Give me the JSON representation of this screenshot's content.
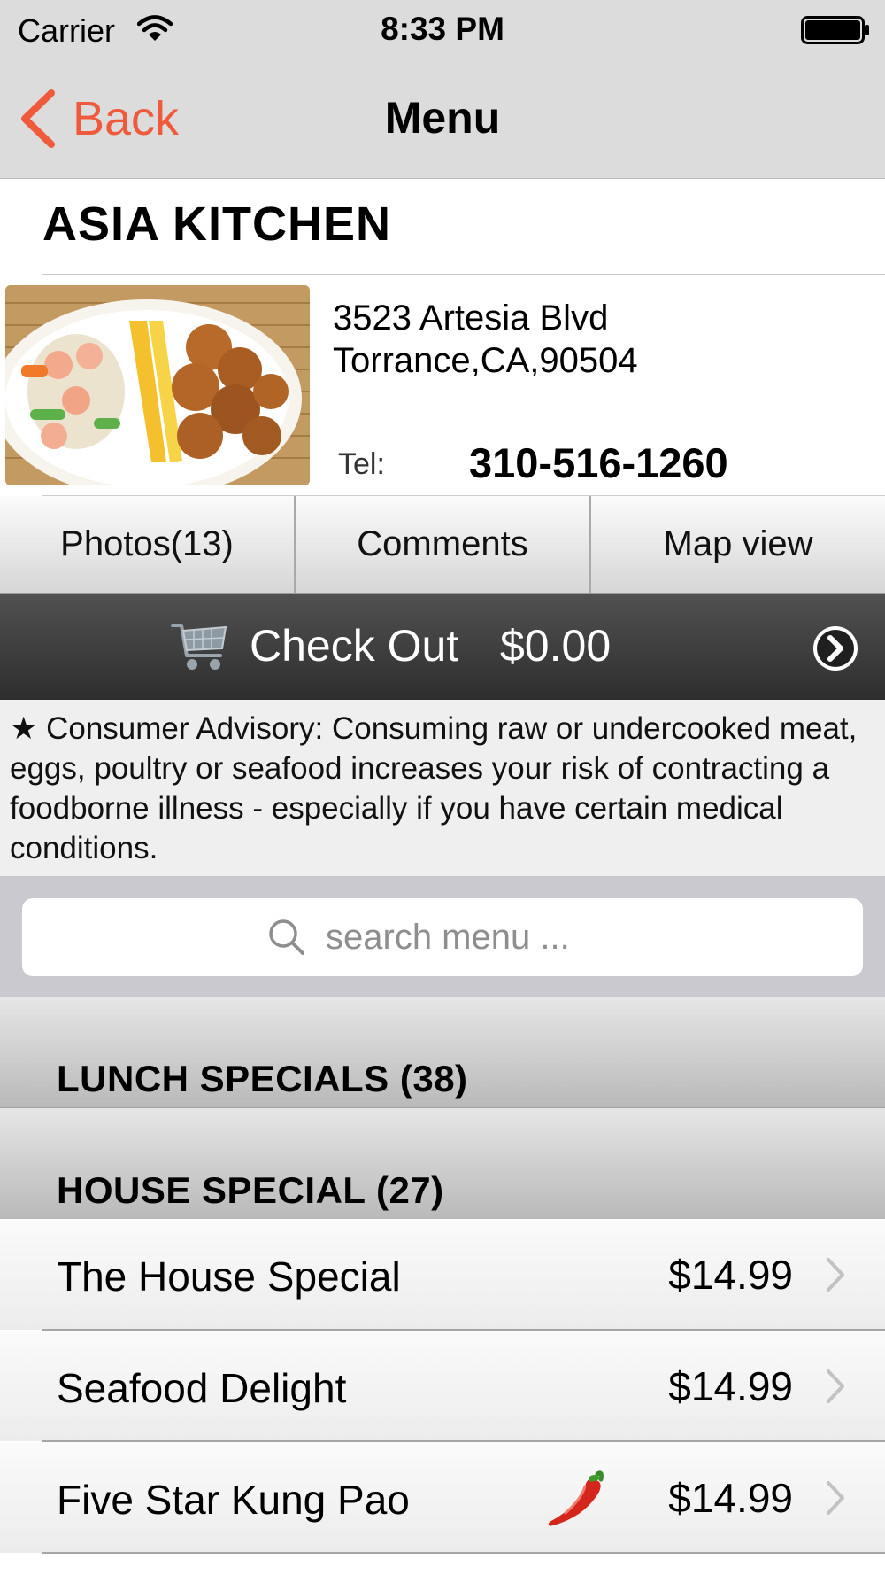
{
  "status_bar": {
    "carrier": "Carrier",
    "time": "8:33 PM"
  },
  "nav": {
    "back_label": "Back",
    "title": "Menu"
  },
  "restaurant": {
    "name": "ASIA KITCHEN",
    "address_line1": "3523 Artesia Blvd",
    "address_line2": "Torrance,CA,90504",
    "tel_label": "Tel:",
    "tel_number": "310-516-1260"
  },
  "tabs": [
    {
      "label": "Photos(13)"
    },
    {
      "label": "Comments"
    },
    {
      "label": "Map view"
    }
  ],
  "checkout": {
    "label": "Check Out",
    "total": "$0.00"
  },
  "advisory": "★ Consumer Advisory: Consuming raw or undercooked meat, eggs, poultry or seafood increases your risk of contracting a foodborne illness - especially if you have certain medical conditions.",
  "search": {
    "placeholder": "search menu ..."
  },
  "sections": [
    {
      "title": "LUNCH SPECIALS (38)"
    },
    {
      "title": "HOUSE SPECIAL (27)"
    }
  ],
  "items": [
    {
      "name": "The House Special",
      "price": "$14.99",
      "spicy": false
    },
    {
      "name": "Seafood Delight",
      "price": "$14.99",
      "spicy": false
    },
    {
      "name": "Five Star Kung Pao",
      "price": "$14.99",
      "spicy": true
    }
  ],
  "colors": {
    "accent": "#f05a3c",
    "nav_bg": "#dcdcdc",
    "checkout_bg": "#3d3d3d"
  },
  "icons": [
    "wifi-icon",
    "battery-icon",
    "back-chevron-icon",
    "cart-icon",
    "arrow-circle-icon",
    "search-icon",
    "chevron-right-icon",
    "chili-pepper-icon"
  ]
}
